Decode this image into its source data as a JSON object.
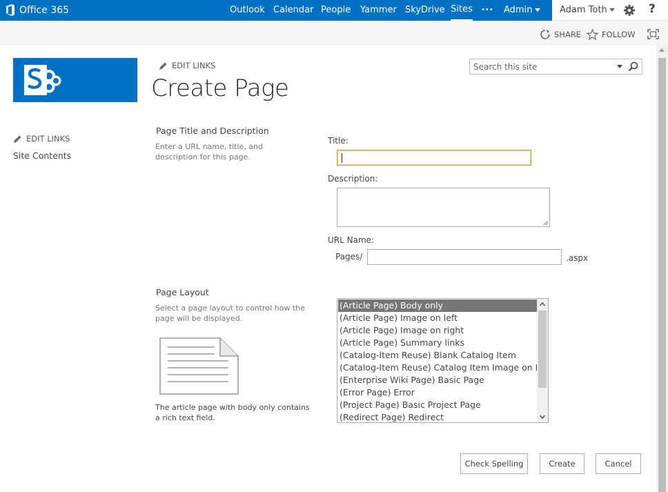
{
  "suite_bar": {
    "brand": "Office 365",
    "nav": [
      {
        "label": "Outlook",
        "active": false
      },
      {
        "label": "Calendar",
        "active": false
      },
      {
        "label": "People",
        "active": false
      },
      {
        "label": "Yammer",
        "active": false
      },
      {
        "label": "SkyDrive",
        "active": false
      },
      {
        "label": "Sites",
        "active": true
      },
      {
        "label": "•••",
        "active": false
      },
      {
        "label": "Admin",
        "active": false
      }
    ],
    "user_name": "Adam Toth",
    "help_label": "?",
    "accent_color": "#0072c6",
    "icons": [
      "office-logo-icon",
      "gear-icon"
    ]
  },
  "ribbon": {
    "share_label": "SHARE",
    "follow_label": "FOLLOW",
    "icons": [
      "share-icon",
      "star-icon",
      "focus-icon"
    ]
  },
  "left_nav": {
    "edit_links_label": "EDIT LINKS",
    "site_contents_label": "Site Contents"
  },
  "header": {
    "edit_links_label": "EDIT LINKS",
    "page_title": "Create Page"
  },
  "search": {
    "placeholder": "Search this site"
  },
  "form": {
    "title_section": {
      "heading": "Page Title and Description",
      "description": "Enter a URL name, title, and description for this page."
    },
    "title_label": "Title:",
    "title_value": "",
    "description_label": "Description:",
    "description_value": "",
    "url_label": "URL Name:",
    "url_prefix": "Pages/",
    "url_value": "",
    "url_suffix": ".aspx",
    "layout_section": {
      "heading": "Page Layout",
      "description": "Select a page layout to control how the page will be displayed.",
      "preview_caption": "The article page with body only contains a rich text field."
    },
    "layouts": [
      "(Article Page) Body only",
      "(Article Page) Image on left",
      "(Article Page) Image on right",
      "(Article Page) Summary links",
      "(Catalog-Item Reuse) Blank Catalog Item",
      "(Catalog-Item Reuse) Catalog Item Image on Left",
      "(Enterprise Wiki Page) Basic Page",
      "(Error Page) Error",
      "(Project Page) Basic Project Page",
      "(Redirect Page) Redirect"
    ],
    "selected_layout_index": 0
  },
  "buttons": {
    "check_spelling": "Check Spelling",
    "create": "Create",
    "cancel": "Cancel"
  }
}
